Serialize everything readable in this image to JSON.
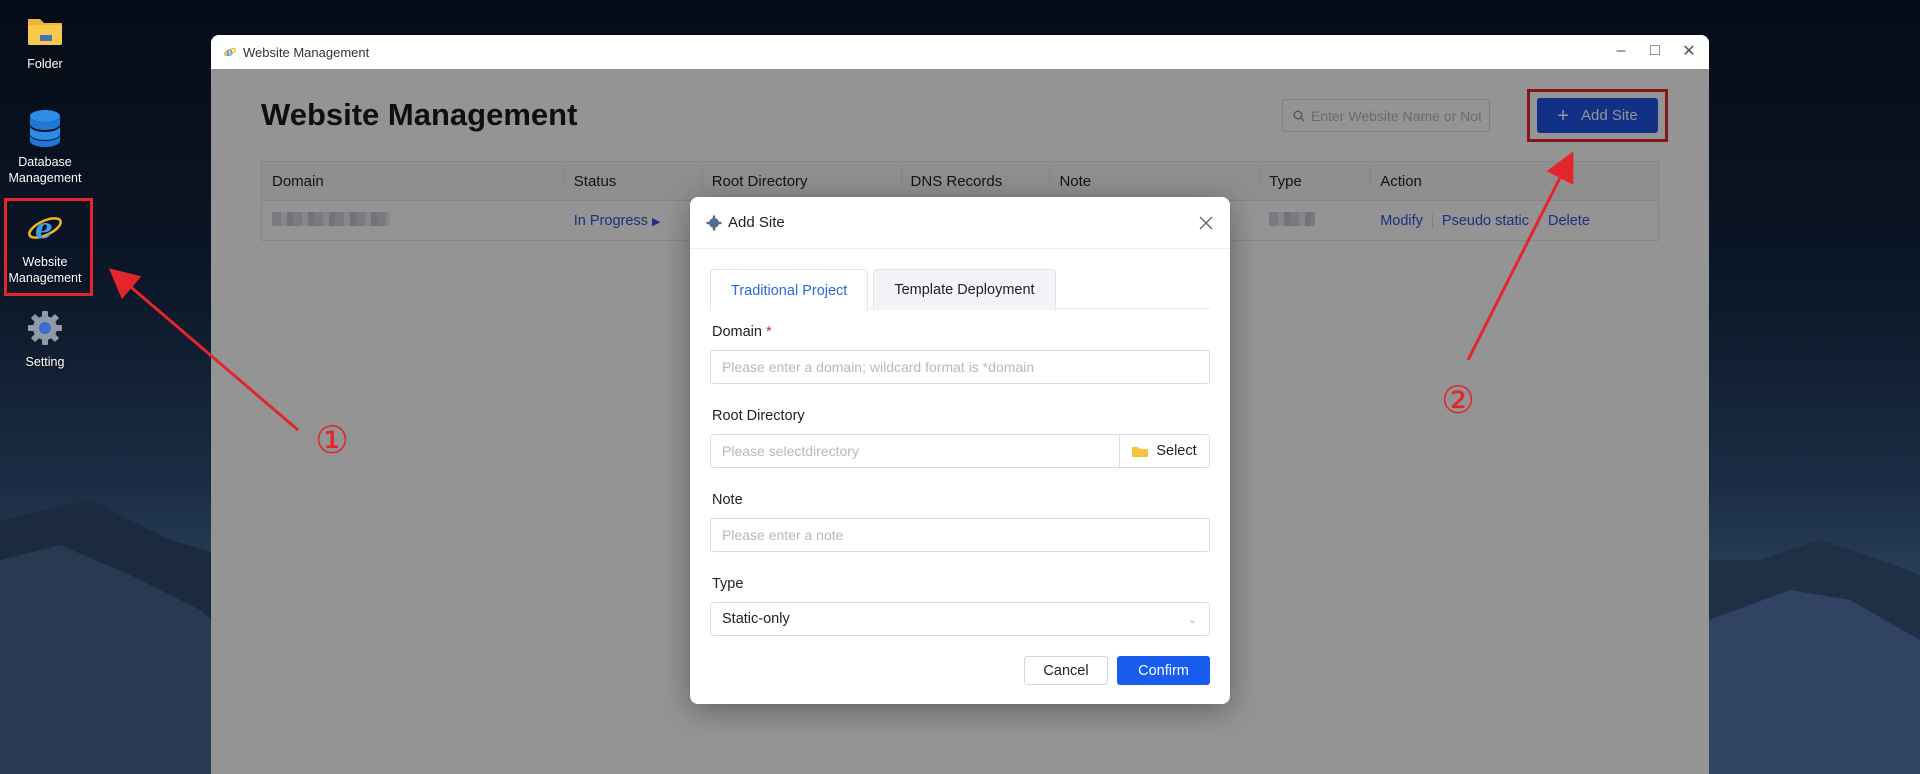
{
  "desktop": {
    "icons": [
      {
        "label": "Folder"
      },
      {
        "label": "Database Management"
      },
      {
        "label": "Website Management"
      },
      {
        "label": "Setting"
      }
    ]
  },
  "window": {
    "title": "Website Management",
    "page_title": "Website Management",
    "search_placeholder": "Enter Website Name or Note",
    "add_button": "Add Site",
    "table": {
      "headers": [
        "Domain",
        "Status",
        "Root Directory",
        "DNS Records",
        "Note",
        "Type",
        "Action"
      ],
      "row": {
        "status": "In Progress",
        "actions": [
          "Modify",
          "Pseudo static",
          "Delete"
        ]
      }
    }
  },
  "modal": {
    "title": "Add Site",
    "tabs": [
      "Traditional Project",
      "Template Deployment"
    ],
    "domain_label": "Domain",
    "domain_required": "*",
    "domain_placeholder": "Please enter a domain; wildcard format is *domain",
    "root_label": "Root Directory",
    "root_placeholder": "Please selectdirectory",
    "select_button": "Select",
    "note_label": "Note",
    "note_placeholder": "Please enter a note",
    "type_label": "Type",
    "type_value": "Static-only",
    "cancel": "Cancel",
    "confirm": "Confirm"
  },
  "annotations": [
    "①",
    "②"
  ],
  "colors": {
    "primary": "#1f53e6",
    "highlight": "#e3262c",
    "link": "#2a56d8"
  }
}
